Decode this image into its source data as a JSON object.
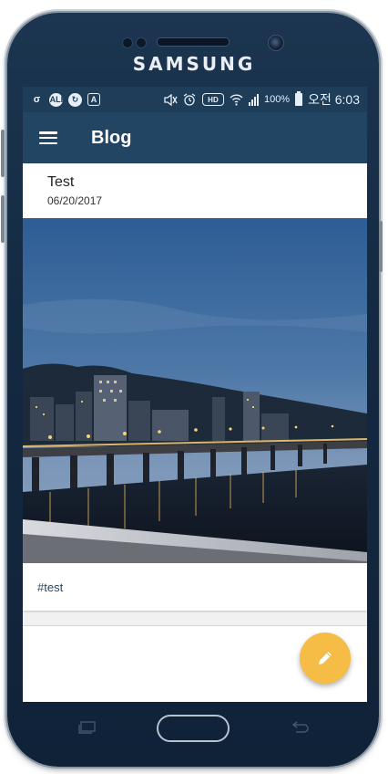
{
  "device": {
    "brand": "SAMSUNG"
  },
  "status_bar": {
    "left_icons": [
      "carrier-icon",
      "chat-icon",
      "sync-icon",
      "font-icon"
    ],
    "right_icons": [
      "mute-icon",
      "alarm-icon",
      "hd-icon",
      "wifi-icon",
      "signal-icon"
    ],
    "battery_percent": "100%",
    "time": "오전 6:03"
  },
  "app_bar": {
    "title": "Blog",
    "menu_icon": "menu-icon"
  },
  "posts": [
    {
      "title": "Test",
      "date": "06/20/2017",
      "tags": "#test",
      "image": "night-river-bridge-photo"
    }
  ],
  "fab": {
    "icon": "pencil-icon",
    "color": "#f5bd45"
  },
  "colors": {
    "app_bar": "#234564",
    "status_bar": "#1e3d58",
    "accent": "#f5bd45"
  }
}
